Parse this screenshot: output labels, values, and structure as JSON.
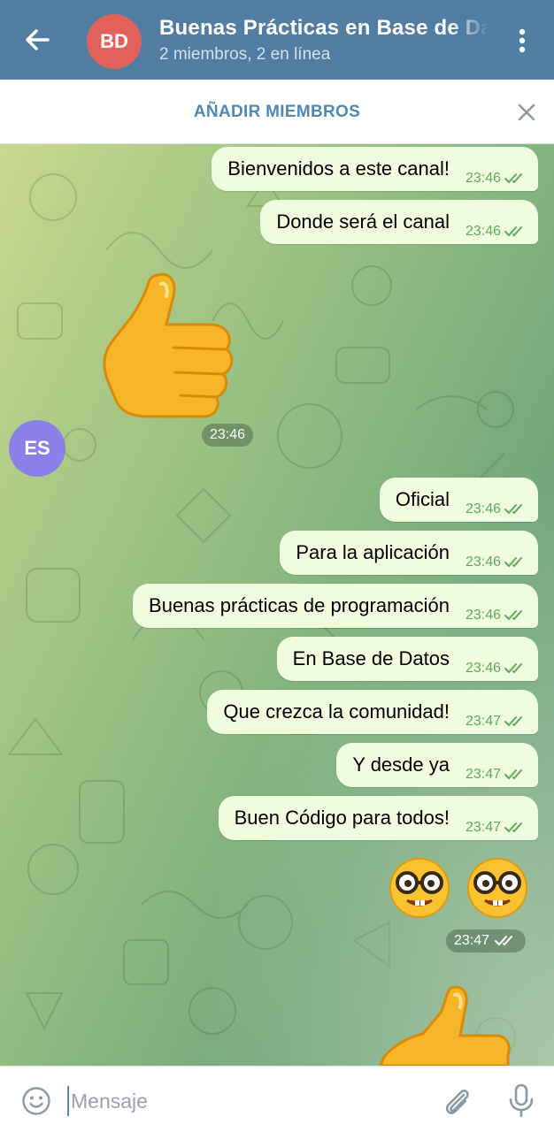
{
  "header": {
    "avatar_initials": "BD",
    "avatar_color": "#e0625a",
    "title": "Buenas Prácticas en Base de Datos",
    "subtitle": "2 miembros, 2 en línea",
    "bar_color": "#517da2"
  },
  "banner": {
    "add_members_label": "AÑADIR MIEMBROS"
  },
  "chat": {
    "sender_initials": "ES",
    "sender_color": "#8b80e8",
    "outgoing_bubble_color": "#effdde",
    "messages_top": [
      {
        "text": "Bienvenidos a este canal!",
        "time": "23:46",
        "status": "read"
      },
      {
        "text": "Donde será el canal",
        "time": "23:46",
        "status": "read"
      }
    ],
    "incoming_sticker": {
      "emoji": "thumbs-up",
      "time": "23:46"
    },
    "messages_bottom": [
      {
        "text": "Oficial",
        "time": "23:46",
        "status": "read"
      },
      {
        "text": "Para la aplicación",
        "time": "23:46",
        "status": "read"
      },
      {
        "text": "Buenas prácticas de programación",
        "time": "23:46",
        "status": "read"
      },
      {
        "text": "En Base de Datos",
        "time": "23:46",
        "status": "read"
      },
      {
        "text": "Que crezca la comunidad!",
        "time": "23:47",
        "status": "read"
      },
      {
        "text": "Y desde ya",
        "time": "23:47",
        "status": "read"
      },
      {
        "text": "Buen Código para todos!",
        "time": "23:47",
        "status": "read"
      }
    ],
    "outgoing_emoji_message": {
      "emojis": [
        "nerd-face",
        "nerd-face"
      ],
      "time": "23:47",
      "status": "read"
    },
    "partial_sticker": {
      "emoji": "thumbs-up"
    }
  },
  "composer": {
    "placeholder": "Mensaje"
  }
}
